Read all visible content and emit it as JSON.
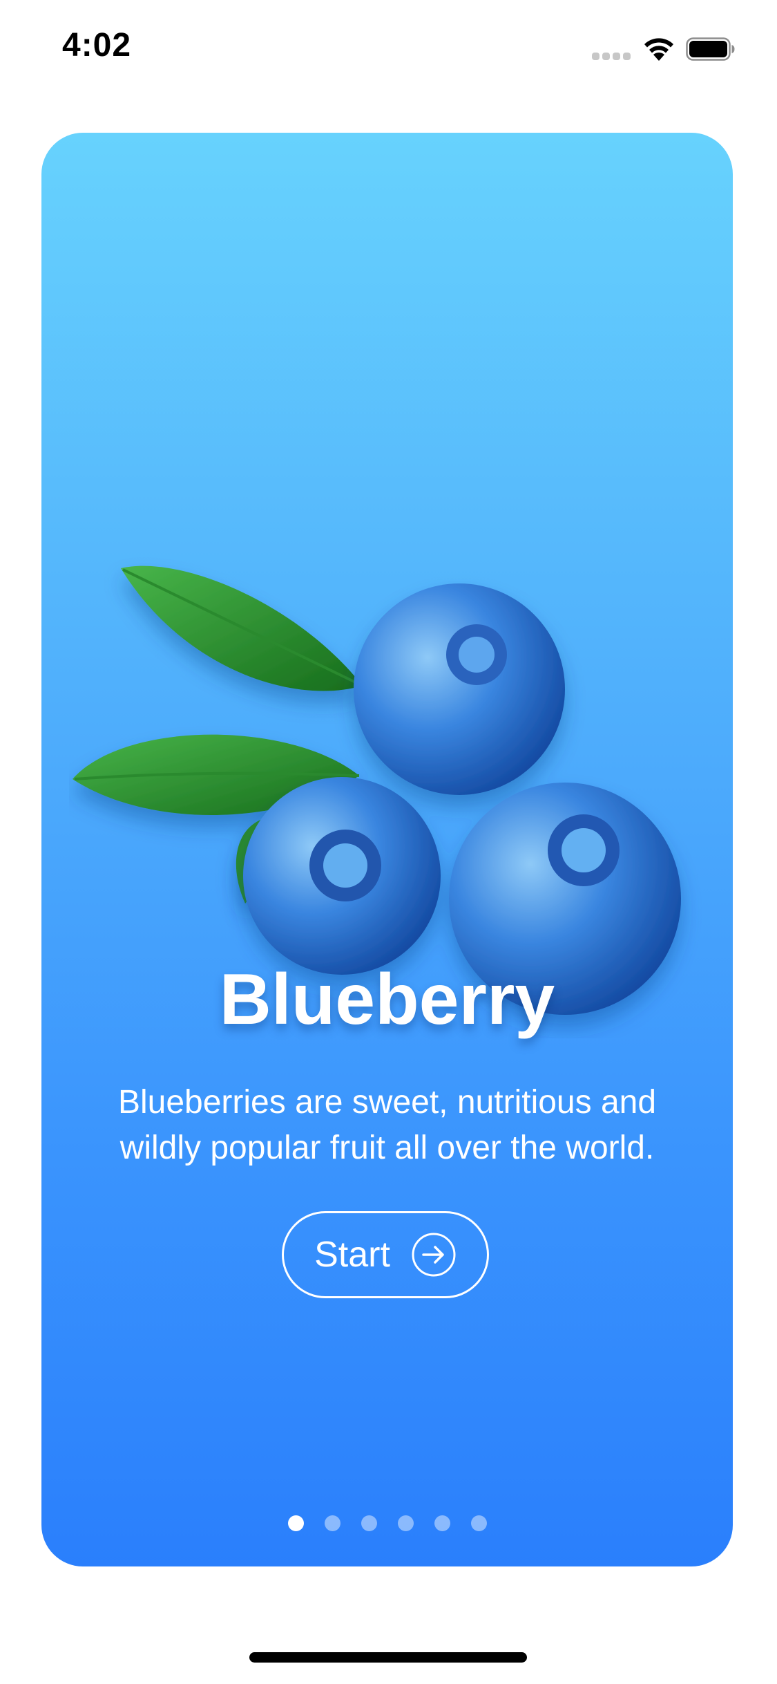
{
  "status_bar": {
    "time": "4:02",
    "icons": [
      "signal-icon",
      "wifi-icon",
      "battery-icon"
    ]
  },
  "onboarding": {
    "title": "Blueberry",
    "description": "Blueberries are sweet, nutritious and wildly popular fruit all over the world.",
    "start_label": "Start",
    "start_icon": "arrow-right-circle-icon",
    "illustration": "blueberries-with-leaves",
    "page_count": 6,
    "current_page": 1,
    "gradient_top": "#67d2fd",
    "gradient_bottom": "#2a7ffc"
  }
}
